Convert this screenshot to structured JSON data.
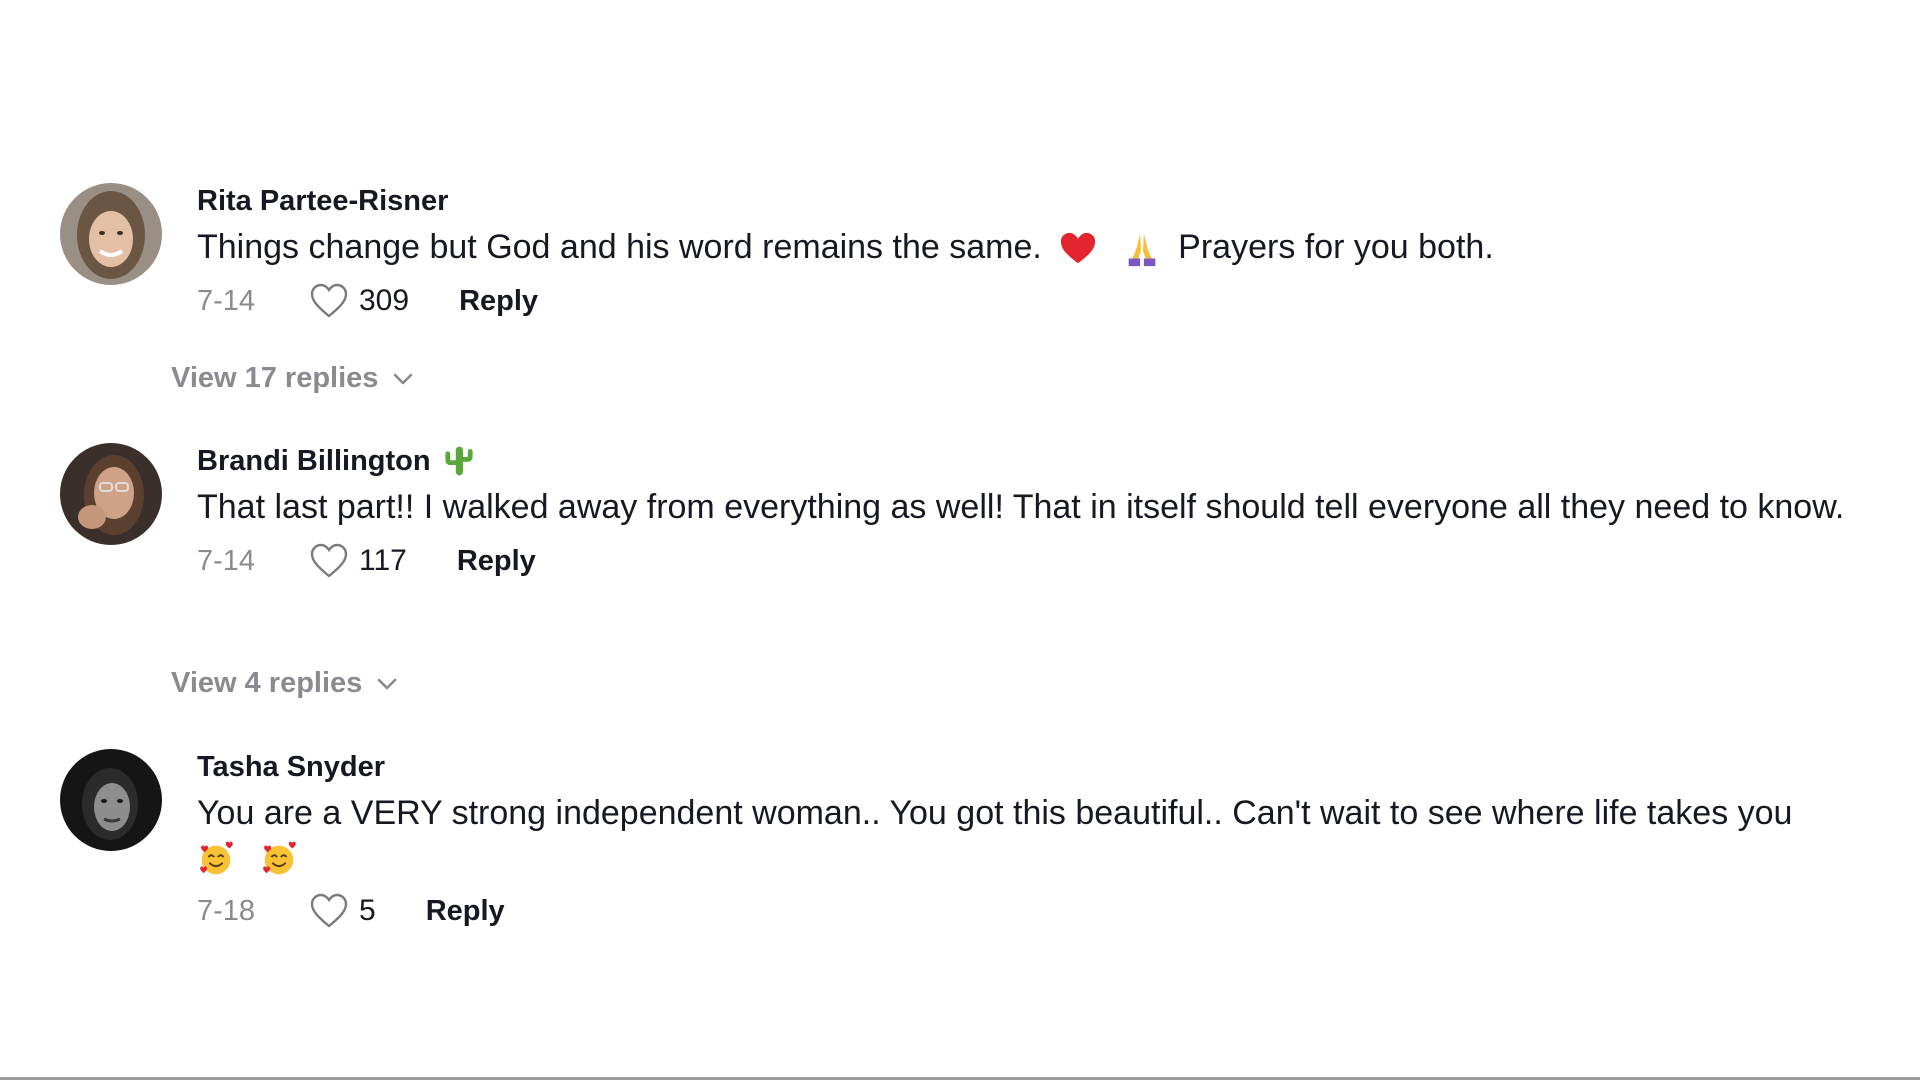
{
  "comments": [
    {
      "username": "Rita Partee-Risner",
      "username_emoji": "",
      "text_before": "Things change but God and his word remains the same.",
      "text_emojis": [
        "red-heart-emoji",
        "folded-hands-emoji"
      ],
      "text_after": "Prayers for you both.",
      "date": "7-14",
      "likes": "309",
      "reply_label": "Reply",
      "view_replies": "View 17 replies"
    },
    {
      "username": "Brandi Billington",
      "username_emoji": "cactus-emoji",
      "text": "That last part!! I walked away from everything as well! That in itself should tell everyone all they need to know.",
      "date": "7-14",
      "likes": "117",
      "reply_label": "Reply",
      "view_replies": "View 4 replies"
    },
    {
      "username": "Tasha Snyder",
      "username_emoji": "",
      "text": "You are a VERY strong independent woman.. You got this beautiful.. Can't wait to see where life takes you",
      "text_emojis": [
        "smiling-face-with-hearts-emoji",
        "smiling-face-with-hearts-emoji"
      ],
      "date": "7-18",
      "likes": "5",
      "reply_label": "Reply"
    }
  ],
  "colors": {
    "text": "#161823",
    "secondary": "#8a8b91",
    "background": "#ffffff"
  },
  "icons": {
    "like": "heart-outline-icon",
    "expand": "chevron-down-icon"
  }
}
